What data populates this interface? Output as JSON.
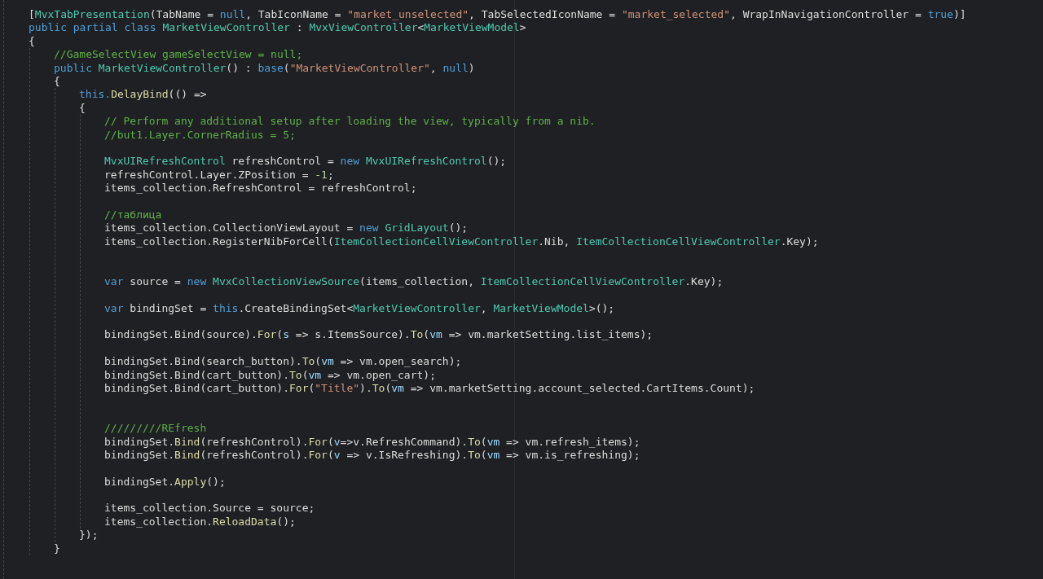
{
  "editor": {
    "lines": [
      {
        "kind": "code",
        "tokens": [
          {
            "kind": "plain",
            "text": "["
          },
          {
            "kind": "type",
            "text": "MvxTabPresentation"
          },
          {
            "kind": "plain",
            "text": "(TabName = "
          },
          {
            "kind": "keyword",
            "text": "null"
          },
          {
            "kind": "plain",
            "text": ", TabIconName = "
          },
          {
            "kind": "string",
            "text": "\"market_unselected\""
          },
          {
            "kind": "plain",
            "text": ", TabSelectedIconName = "
          },
          {
            "kind": "string",
            "text": "\"market_selected\""
          },
          {
            "kind": "plain",
            "text": ", WrapInNavigationController = "
          },
          {
            "kind": "keyword",
            "text": "true"
          },
          {
            "kind": "plain",
            "text": ")]"
          }
        ]
      },
      {
        "kind": "code",
        "tokens": [
          {
            "kind": "keyword",
            "text": "public partial class "
          },
          {
            "kind": "type",
            "text": "MarketViewController"
          },
          {
            "kind": "plain",
            "text": " : "
          },
          {
            "kind": "type",
            "text": "MvxViewController"
          },
          {
            "kind": "plain",
            "text": "<"
          },
          {
            "kind": "type",
            "text": "MarketViewModel"
          },
          {
            "kind": "plain",
            "text": ">"
          }
        ]
      },
      {
        "kind": "code",
        "tokens": [
          {
            "kind": "plain",
            "text": "{"
          }
        ],
        "children": [
          {
            "kind": "code",
            "tokens": [
              {
                "kind": "comment",
                "text": "//GameSelectView gameSelectView = null;"
              }
            ]
          },
          {
            "kind": "code",
            "tokens": [
              {
                "kind": "keyword",
                "text": "public "
              },
              {
                "kind": "type",
                "text": "MarketViewController"
              },
              {
                "kind": "plain",
                "text": "() : "
              },
              {
                "kind": "keyword",
                "text": "base"
              },
              {
                "kind": "plain",
                "text": "("
              },
              {
                "kind": "string",
                "text": "\"MarketViewController\""
              },
              {
                "kind": "plain",
                "text": ", "
              },
              {
                "kind": "keyword",
                "text": "null"
              },
              {
                "kind": "plain",
                "text": ")"
              }
            ]
          },
          {
            "kind": "code",
            "tokens": [
              {
                "kind": "plain",
                "text": "{"
              }
            ],
            "children": [
              {
                "kind": "code",
                "tokens": [
                  {
                    "kind": "keyword",
                    "text": "this."
                  },
                  {
                    "kind": "method",
                    "text": "DelayBind"
                  },
                  {
                    "kind": "plain",
                    "text": "(() =>"
                  }
                ]
              },
              {
                "kind": "code",
                "tokens": [
                  {
                    "kind": "plain",
                    "text": "{"
                  }
                ],
                "children": [
                  {
                    "kind": "code",
                    "tokens": [
                      {
                        "kind": "comment",
                        "text": "// Perform any additional setup after loading the view, typically from a nib."
                      }
                    ]
                  },
                  {
                    "kind": "code",
                    "tokens": [
                      {
                        "kind": "comment",
                        "text": "//but1.Layer.CornerRadius = 5;"
                      }
                    ]
                  },
                  {
                    "kind": "blank"
                  },
                  {
                    "kind": "code",
                    "tokens": [
                      {
                        "kind": "type",
                        "text": "MvxUIRefreshControl"
                      },
                      {
                        "kind": "plain",
                        "text": " refreshControl = "
                      },
                      {
                        "kind": "keyword",
                        "text": "new "
                      },
                      {
                        "kind": "type",
                        "text": "MvxUIRefreshControl"
                      },
                      {
                        "kind": "plain",
                        "text": "();"
                      }
                    ]
                  },
                  {
                    "kind": "code",
                    "tokens": [
                      {
                        "kind": "plain",
                        "text": "refreshControl.Layer.ZPosition = "
                      },
                      {
                        "kind": "number",
                        "text": "-1"
                      },
                      {
                        "kind": "plain",
                        "text": ";"
                      }
                    ]
                  },
                  {
                    "kind": "code",
                    "tokens": [
                      {
                        "kind": "plain",
                        "text": "items_collection.RefreshControl = refreshControl;"
                      }
                    ]
                  },
                  {
                    "kind": "blank"
                  },
                  {
                    "kind": "code",
                    "tokens": [
                      {
                        "kind": "comment",
                        "text": "//таблица"
                      }
                    ]
                  },
                  {
                    "kind": "code",
                    "tokens": [
                      {
                        "kind": "plain",
                        "text": "items_collection.CollectionViewLayout = "
                      },
                      {
                        "kind": "keyword",
                        "text": "new "
                      },
                      {
                        "kind": "type",
                        "text": "GridLayout"
                      },
                      {
                        "kind": "plain",
                        "text": "();"
                      }
                    ]
                  },
                  {
                    "kind": "code",
                    "tokens": [
                      {
                        "kind": "plain",
                        "text": "items_collection.RegisterNibForCell("
                      },
                      {
                        "kind": "type",
                        "text": "ItemCollectionCellViewController"
                      },
                      {
                        "kind": "plain",
                        "text": ".Nib, "
                      },
                      {
                        "kind": "type",
                        "text": "ItemCollectionCellViewController"
                      },
                      {
                        "kind": "plain",
                        "text": ".Key);"
                      }
                    ]
                  },
                  {
                    "kind": "blank"
                  },
                  {
                    "kind": "blank"
                  },
                  {
                    "kind": "code",
                    "tokens": [
                      {
                        "kind": "keyword",
                        "text": "var"
                      },
                      {
                        "kind": "plain",
                        "text": " source = "
                      },
                      {
                        "kind": "keyword",
                        "text": "new "
                      },
                      {
                        "kind": "type",
                        "text": "MvxCollectionViewSource"
                      },
                      {
                        "kind": "plain",
                        "text": "(items_collection, "
                      },
                      {
                        "kind": "type",
                        "text": "ItemCollectionCellViewController"
                      },
                      {
                        "kind": "plain",
                        "text": ".Key);"
                      }
                    ]
                  },
                  {
                    "kind": "blank"
                  },
                  {
                    "kind": "code",
                    "tokens": [
                      {
                        "kind": "keyword",
                        "text": "var"
                      },
                      {
                        "kind": "plain",
                        "text": " bindingSet = "
                      },
                      {
                        "kind": "keyword",
                        "text": "this"
                      },
                      {
                        "kind": "plain",
                        "text": ".CreateBindingSet<"
                      },
                      {
                        "kind": "type",
                        "text": "MarketViewController"
                      },
                      {
                        "kind": "plain",
                        "text": ", "
                      },
                      {
                        "kind": "type",
                        "text": "MarketViewModel"
                      },
                      {
                        "kind": "plain",
                        "text": ">();"
                      }
                    ]
                  },
                  {
                    "kind": "blank"
                  },
                  {
                    "kind": "code",
                    "tokens": [
                      {
                        "kind": "plain",
                        "text": "bindingSet.Bind(source)."
                      },
                      {
                        "kind": "method",
                        "text": "For"
                      },
                      {
                        "kind": "plain",
                        "text": "("
                      },
                      {
                        "kind": "param",
                        "text": "s"
                      },
                      {
                        "kind": "plain",
                        "text": " => s.ItemsSource)."
                      },
                      {
                        "kind": "method",
                        "text": "To"
                      },
                      {
                        "kind": "plain",
                        "text": "("
                      },
                      {
                        "kind": "param",
                        "text": "vm"
                      },
                      {
                        "kind": "plain",
                        "text": " => vm.marketSetting.list_items);"
                      }
                    ]
                  },
                  {
                    "kind": "blank"
                  },
                  {
                    "kind": "code",
                    "tokens": [
                      {
                        "kind": "plain",
                        "text": "bindingSet.Bind(search_button)."
                      },
                      {
                        "kind": "method",
                        "text": "To"
                      },
                      {
                        "kind": "plain",
                        "text": "("
                      },
                      {
                        "kind": "param",
                        "text": "vm"
                      },
                      {
                        "kind": "plain",
                        "text": " => vm.open_search);"
                      }
                    ]
                  },
                  {
                    "kind": "code",
                    "tokens": [
                      {
                        "kind": "plain",
                        "text": "bindingSet.Bind(cart_button)."
                      },
                      {
                        "kind": "method",
                        "text": "To"
                      },
                      {
                        "kind": "plain",
                        "text": "("
                      },
                      {
                        "kind": "param",
                        "text": "vm"
                      },
                      {
                        "kind": "plain",
                        "text": " => vm.open_cart);"
                      }
                    ]
                  },
                  {
                    "kind": "code",
                    "tokens": [
                      {
                        "kind": "plain",
                        "text": "bindingSet.Bind(cart_button)."
                      },
                      {
                        "kind": "method",
                        "text": "For"
                      },
                      {
                        "kind": "plain",
                        "text": "("
                      },
                      {
                        "kind": "string",
                        "text": "\"Title\""
                      },
                      {
                        "kind": "plain",
                        "text": ")."
                      },
                      {
                        "kind": "method",
                        "text": "To"
                      },
                      {
                        "kind": "plain",
                        "text": "("
                      },
                      {
                        "kind": "param",
                        "text": "vm"
                      },
                      {
                        "kind": "plain",
                        "text": " => vm.marketSetting.account_selected.CartItems.Count);"
                      }
                    ]
                  },
                  {
                    "kind": "blank"
                  },
                  {
                    "kind": "blank"
                  },
                  {
                    "kind": "code",
                    "tokens": [
                      {
                        "kind": "comment",
                        "text": "/////////REfresh"
                      }
                    ]
                  },
                  {
                    "kind": "code",
                    "tokens": [
                      {
                        "kind": "plain",
                        "text": "bindingSet."
                      },
                      {
                        "kind": "method",
                        "text": "Bind"
                      },
                      {
                        "kind": "plain",
                        "text": "(refreshControl)."
                      },
                      {
                        "kind": "method",
                        "text": "For"
                      },
                      {
                        "kind": "plain",
                        "text": "("
                      },
                      {
                        "kind": "param",
                        "text": "v"
                      },
                      {
                        "kind": "plain",
                        "text": "=>v.RefreshCommand)."
                      },
                      {
                        "kind": "method",
                        "text": "To"
                      },
                      {
                        "kind": "plain",
                        "text": "("
                      },
                      {
                        "kind": "param",
                        "text": "vm"
                      },
                      {
                        "kind": "plain",
                        "text": " => vm.refresh_items);"
                      }
                    ]
                  },
                  {
                    "kind": "code",
                    "tokens": [
                      {
                        "kind": "plain",
                        "text": "bindingSet."
                      },
                      {
                        "kind": "method",
                        "text": "Bind"
                      },
                      {
                        "kind": "plain",
                        "text": "(refreshControl)."
                      },
                      {
                        "kind": "method",
                        "text": "For"
                      },
                      {
                        "kind": "plain",
                        "text": "("
                      },
                      {
                        "kind": "param",
                        "text": "v"
                      },
                      {
                        "kind": "plain",
                        "text": " => v.IsRefreshing)."
                      },
                      {
                        "kind": "method",
                        "text": "To"
                      },
                      {
                        "kind": "plain",
                        "text": "("
                      },
                      {
                        "kind": "param",
                        "text": "vm"
                      },
                      {
                        "kind": "plain",
                        "text": " => vm.is_refreshing);"
                      }
                    ]
                  },
                  {
                    "kind": "blank"
                  },
                  {
                    "kind": "code",
                    "tokens": [
                      {
                        "kind": "plain",
                        "text": "bindingSet."
                      },
                      {
                        "kind": "method",
                        "text": "Apply"
                      },
                      {
                        "kind": "plain",
                        "text": "();"
                      }
                    ]
                  },
                  {
                    "kind": "blank"
                  },
                  {
                    "kind": "code",
                    "tokens": [
                      {
                        "kind": "plain",
                        "text": "items_collection.Source = source;"
                      }
                    ]
                  },
                  {
                    "kind": "code",
                    "tokens": [
                      {
                        "kind": "plain",
                        "text": "items_collection."
                      },
                      {
                        "kind": "method",
                        "text": "ReloadData"
                      },
                      {
                        "kind": "plain",
                        "text": "();"
                      }
                    ]
                  }
                ]
              },
              {
                "kind": "code",
                "tokens": [
                  {
                    "kind": "plain",
                    "text": "});"
                  }
                ]
              }
            ]
          },
          {
            "kind": "code",
            "tokens": [
              {
                "kind": "plain",
                "text": "}"
              }
            ]
          }
        ]
      }
    ]
  }
}
